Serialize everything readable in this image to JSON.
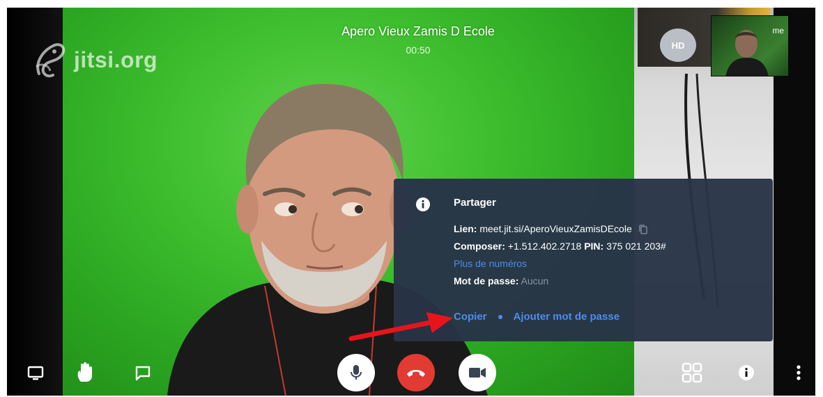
{
  "watermark": {
    "text": "jitsi.org"
  },
  "conference": {
    "title": "Apero Vieux Zamis D Ecole",
    "timer": "00:50"
  },
  "quality_badge": "HD",
  "thumbnail": {
    "name": "me"
  },
  "share": {
    "title": "Partager",
    "link_label": "Lien:",
    "link_value": "meet.jit.si/AperoVieuxZamisDEcole",
    "dial_label": "Composer:",
    "dial_value": "+1.512.402.2718",
    "pin_label": "PIN:",
    "pin_value": "375 021 203#",
    "more_numbers": "Plus de numéros",
    "password_label": "Mot de passe:",
    "password_value": "Aucun",
    "copy_action": "Copier",
    "add_password_action": "Ajouter mot de passe"
  },
  "colors": {
    "accent_blue": "#4a8df0",
    "hangup_red": "#e23b33",
    "popup_bg": "#283447",
    "annotation_arrow": "#e8141b"
  },
  "toolbar": {
    "left": [
      "screen-share-icon",
      "raise-hand-icon",
      "chat-icon"
    ],
    "center": [
      "microphone-icon",
      "hangup-icon",
      "camera-icon"
    ],
    "right": [
      "tile-view-icon",
      "info-icon",
      "more-options-icon"
    ]
  }
}
